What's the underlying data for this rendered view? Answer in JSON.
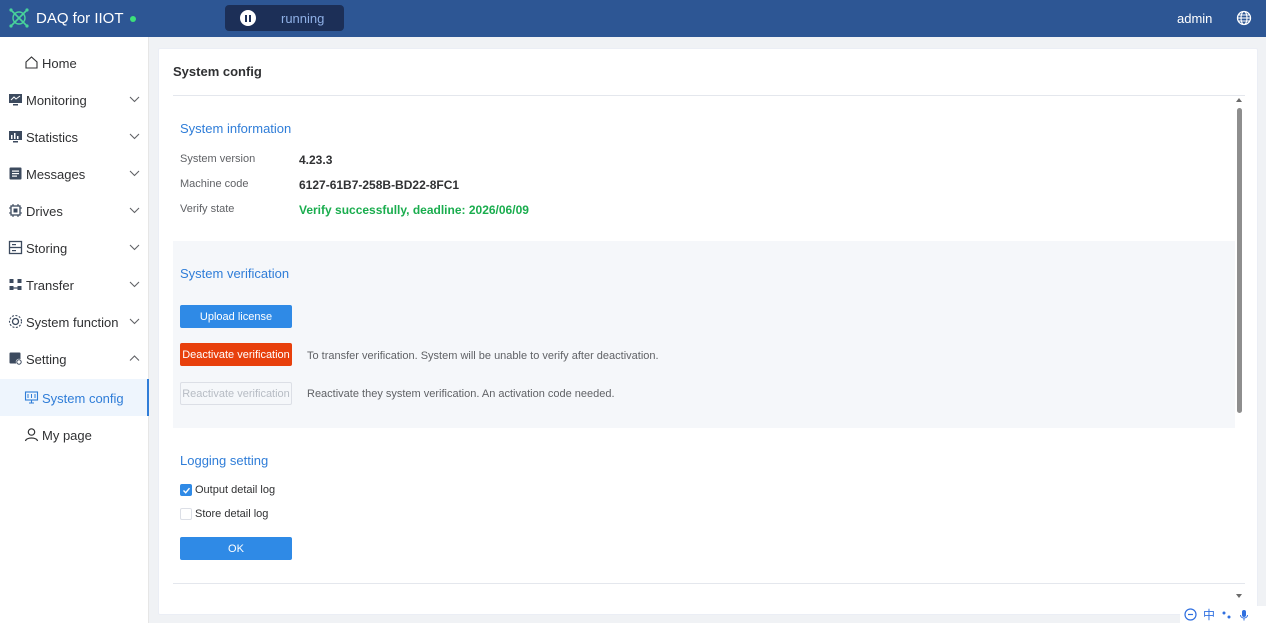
{
  "header": {
    "app_title": "DAQ for IIOT",
    "run_status": "running",
    "user": "admin",
    "status_color": "#3ce07a",
    "brand_color": "#2d5694"
  },
  "sidebar": {
    "items": [
      {
        "label": "Home",
        "icon": "home-icon"
      },
      {
        "label": "Monitoring",
        "icon": "monitor-icon"
      },
      {
        "label": "Statistics",
        "icon": "statistics-icon"
      },
      {
        "label": "Messages",
        "icon": "messages-icon"
      },
      {
        "label": "Drives",
        "icon": "drive-icon"
      },
      {
        "label": "Storing",
        "icon": "storage-icon"
      },
      {
        "label": "Transfer",
        "icon": "transfer-icon"
      },
      {
        "label": "System function",
        "icon": "system-function-icon"
      },
      {
        "label": "Setting",
        "icon": "setting-icon"
      },
      {
        "label": "System config",
        "icon": "system-config-icon",
        "active": true
      },
      {
        "label": "My page",
        "icon": "user-icon"
      }
    ]
  },
  "main": {
    "title": "System config",
    "system_info": {
      "title": "System information",
      "version_label": "System version",
      "version_value": "4.23.3",
      "machine_label": "Machine code",
      "machine_value": "6127-61B7-258B-BD22-8FC1",
      "verify_label": "Verify state",
      "verify_value": "Verify successfully, deadline: 2026/06/09"
    },
    "verification": {
      "title": "System verification",
      "upload_label": "Upload license",
      "deactivate_label": "Deactivate verification",
      "deactivate_hint": "To transfer verification. System will be unable to verify after deactivation.",
      "reactivate_label": "Reactivate verification",
      "reactivate_hint": "Reactivate they system verification. An activation code needed."
    },
    "logging": {
      "title": "Logging setting",
      "output_detail_log": {
        "label": "Output detail log",
        "checked": true
      },
      "store_detail_log": {
        "label": "Store detail log",
        "checked": false
      },
      "ok_label": "OK"
    }
  },
  "ime": {
    "lang": "中"
  }
}
